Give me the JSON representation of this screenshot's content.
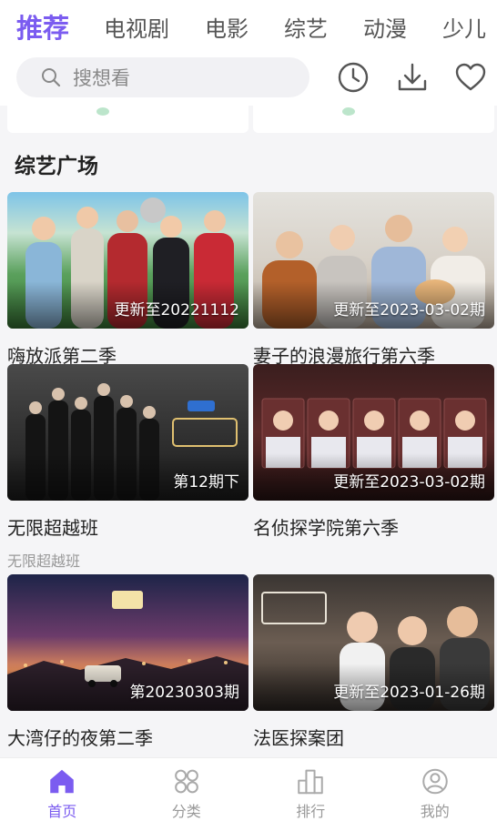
{
  "tabs": [
    "推荐",
    "电视剧",
    "电影",
    "综艺",
    "动漫",
    "少儿"
  ],
  "search": {
    "placeholder": "搜想看"
  },
  "section_title": "综艺广场",
  "cards": [
    {
      "title": "嗨放派第二季",
      "badge": "更新至20221112",
      "subtitle": ""
    },
    {
      "title": "妻子的浪漫旅行第六季",
      "badge": "更新至2023-03-02期",
      "subtitle": ""
    },
    {
      "title": "无限超越班",
      "badge": "第12期下",
      "subtitle": "无限超越班"
    },
    {
      "title": "名侦探学院第六季",
      "badge": "更新至2023-03-02期",
      "subtitle": ""
    },
    {
      "title": "大湾仔的夜第二季",
      "badge": "第20230303期",
      "subtitle": ""
    },
    {
      "title": "法医探案团",
      "badge": "更新至2023-01-26期",
      "subtitle": ""
    }
  ],
  "bottom_nav": [
    {
      "label": "首页",
      "icon": "home-icon"
    },
    {
      "label": "分类",
      "icon": "category-icon"
    },
    {
      "label": "排行",
      "icon": "ranking-icon"
    },
    {
      "label": "我的",
      "icon": "profile-icon"
    }
  ],
  "colors": {
    "accent": "#7b5cf0",
    "inactive": "#999999"
  }
}
